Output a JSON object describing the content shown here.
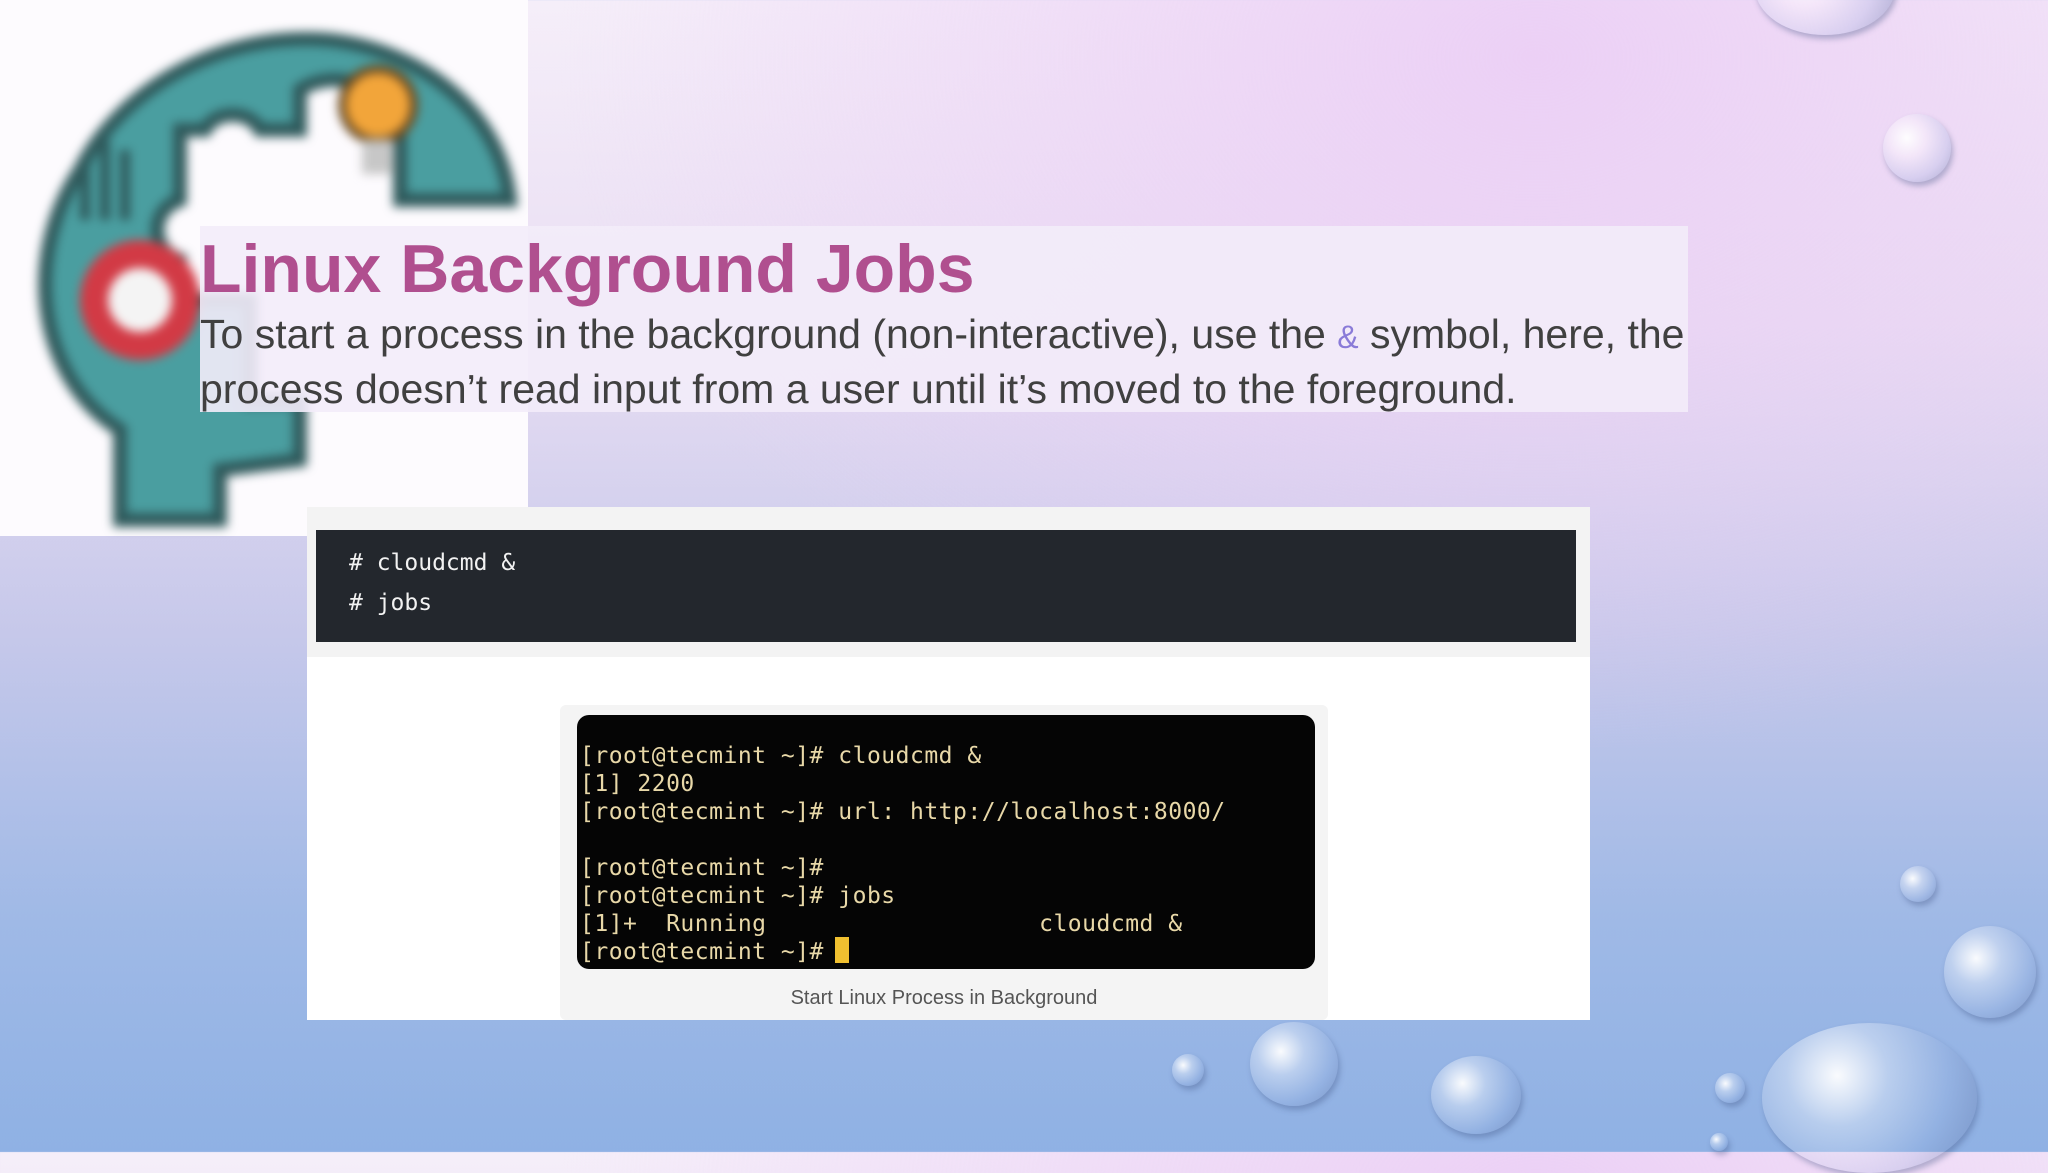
{
  "slide": {
    "title": "Linux Background Jobs",
    "body_part1": "To start a process in the background (non-interactive), use the ",
    "body_symbol": "&",
    "body_part2": " symbol, here, the process doesn’t read input from a user until it’s moved to the foreground."
  },
  "code_block": {
    "lines": [
      "# cloudcmd &",
      "# jobs"
    ]
  },
  "terminal": {
    "lines": [
      "[root@tecmint ~]# cloudcmd &",
      "[1] 2200",
      "[root@tecmint ~]# url: http://localhost:8000/",
      "",
      "[root@tecmint ~]#",
      "[root@tecmint ~]# jobs",
      "[1]+  Running                   cloudcmd &",
      "[root@tecmint ~]# "
    ]
  },
  "caption": "Start Linux Process in Background",
  "icons": {
    "logo": "head-puzzle-gear-lightbulb-icon"
  },
  "colors": {
    "title": "#b04f8f",
    "body": "#404040",
    "code_bg": "#23272d",
    "terminal_bg": "#050505",
    "terminal_text": "#e8d8a8"
  }
}
